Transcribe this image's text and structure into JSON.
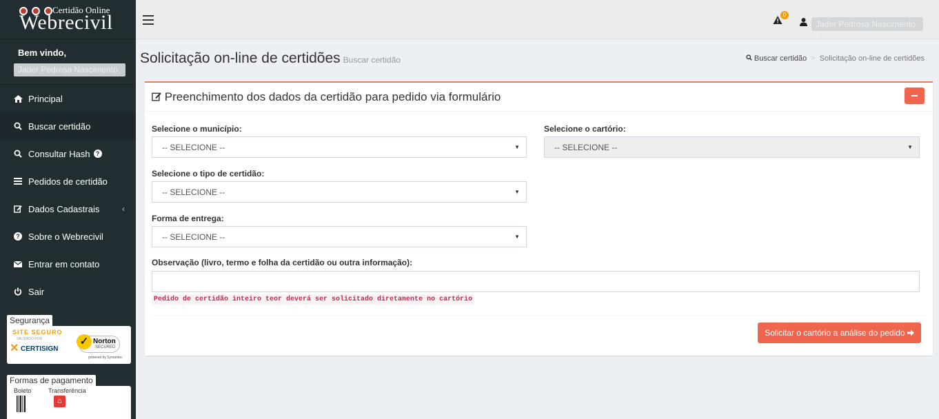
{
  "brand": {
    "small": "Certidão Online",
    "big": "Webrecivil"
  },
  "sidebar": {
    "welcome": "Bem vindo,",
    "user": "Jader Pedrosa Nascimento",
    "items": [
      {
        "label": "Principal",
        "icon": "home-icon"
      },
      {
        "label": "Buscar certidão",
        "icon": "search-icon"
      },
      {
        "label": "Consultar Hash",
        "icon": "search-icon"
      },
      {
        "label": "Pedidos de certidão",
        "icon": "list-icon"
      },
      {
        "label": "Dados Cadastrais",
        "icon": "edit-icon"
      },
      {
        "label": "Sobre o Webrecivil",
        "icon": "question-circle-icon"
      },
      {
        "label": "Entrar em contato",
        "icon": "envelope-icon"
      },
      {
        "label": "Sair",
        "icon": "power-icon"
      }
    ],
    "security": {
      "title": "Segurança",
      "site_seguro": "SITE SEGURO",
      "validado": "VALIDADO POR",
      "certisign": "CERTISIGN",
      "norton": "Norton",
      "secured": "SECURED",
      "powered": "powered by Symantec"
    },
    "payments": {
      "title": "Formas de pagamento",
      "boleto": "Boleto",
      "transferencia": "Transferência"
    }
  },
  "topbar": {
    "badge": "0",
    "user": "Jader Pedrosa Nascimento"
  },
  "header": {
    "title": "Solicitação on-line de certidões",
    "subtitle": "Buscar certidão"
  },
  "breadcrumb": {
    "link": "Buscar certidão",
    "current": "Solicitação on-line de certidões"
  },
  "form": {
    "title": "Preenchimento dos dados da certidão para pedido via formulário",
    "municipio_label": "Selecione o município:",
    "cartorio_label": "Selecione o cartório:",
    "tipo_label": "Selecione o tipo de certidão:",
    "entrega_label": "Forma de entrega:",
    "obs_label": "Observação (livro, termo e folha da certidão ou outra informação):",
    "select_default": "-- SELECIONE --",
    "warning": "Pedido de certidão inteiro teor deverá ser solicitado diretamente no cartório",
    "submit": "Solicitar o cartório a análise do pedido"
  },
  "colors": {
    "accent": "#f0654d",
    "sidebar": "#222d32"
  }
}
